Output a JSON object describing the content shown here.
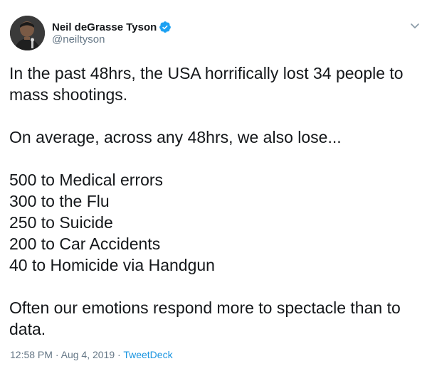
{
  "author": {
    "display_name": "Neil deGrasse Tyson",
    "handle": "@neiltyson",
    "verified": true,
    "avatar_icon": "profile-photo"
  },
  "tweet": {
    "paragraph_1": "In the past 48hrs, the USA horrifically lost 34 people to mass shootings.",
    "paragraph_2": "On average, across any 48hrs, we also lose...",
    "list": [
      "500 to Medical errors",
      "300 to the Flu",
      "250 to Suicide",
      "200 to Car Accidents",
      "40 to Homicide via Handgun"
    ],
    "paragraph_3": "Often our emotions respond more to spectacle than to data."
  },
  "meta": {
    "time": "12:58 PM",
    "separator_1": " · ",
    "date": "Aug 4, 2019",
    "separator_2": " · ",
    "source": "TweetDeck"
  },
  "colors": {
    "verified_blue": "#1da1f2",
    "link_blue": "#1b95e0",
    "secondary_gray": "#657786"
  },
  "icons": {
    "verified": "verified-badge-icon",
    "caret": "chevron-down-icon"
  }
}
